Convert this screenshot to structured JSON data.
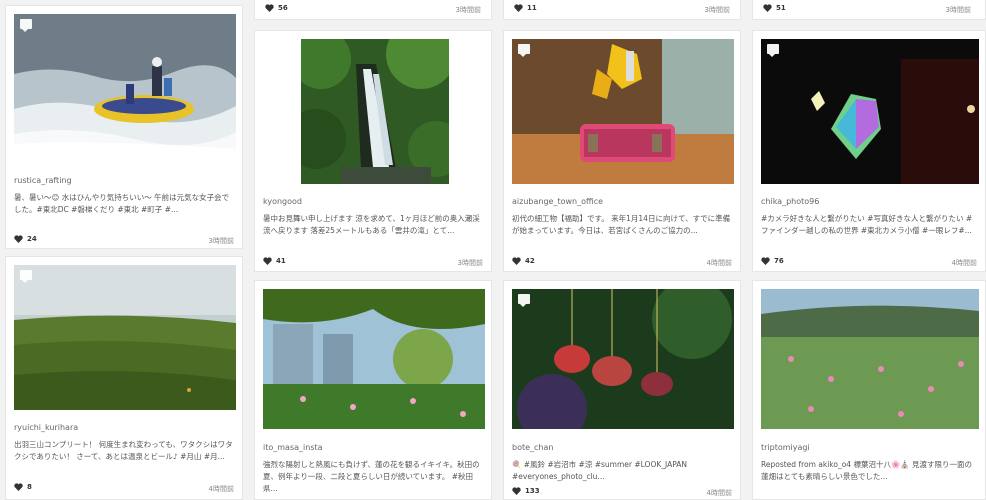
{
  "top_row": [
    {
      "likes": "56",
      "time": "3時間前"
    },
    {
      "likes": "11",
      "time": "3時間前"
    },
    {
      "likes": "51",
      "time": "3時間前"
    }
  ],
  "cards": [
    {
      "user": "rustica_rafting",
      "caption": "暑、暑い〜😊 水はひんやり気持ちいい〜 午前は元気な女子会でした。#東北DC #磐梯くだり #東北 #町子 #...",
      "likes": "24",
      "time": "3時間前"
    },
    {
      "user": "kyongood",
      "caption": "暑中お見舞い申し上げます 涼を求めて、1ヶ月ほど前の奥入瀬渓流へ戻ります 落差25メートルもある「雲井の滝」とて...",
      "likes": "41",
      "time": "3時間前"
    },
    {
      "user": "aizubange_town_office",
      "caption": "初代の細工物【福助】です。 来年1月14日に向けて、すでに準備が始まっています。今日は、若宮ばくさんのご協力の...",
      "likes": "42",
      "time": "4時間前"
    },
    {
      "user": "chika_photo96",
      "caption": "#カメラ好きな人と繋がりたい #写真好きな人と繋がりたい #ファインダー越しの私の世界 #東北カメラ小僧 #一眼レフ#...",
      "likes": "76",
      "time": "4時間前"
    },
    {
      "user": "ryuichi_kurihara",
      "caption": "出羽三山コンプリート！ 何度生まれ変わっても、ワタクシはワタクシでありたい！ さーて、あとは温泉とビール♪ #月山 #月...",
      "likes": "8",
      "time": "4時間前"
    },
    {
      "user": "ito_masa_insta",
      "caption": "強烈な陽射しと熱風にも負けず、蓮の花を観るイキイキ。秋田の夏、例年より一段、二段と夏らしい日が続いています。 #秋田県...",
      "likes": "",
      "time": ""
    },
    {
      "user": "bote_chan",
      "caption": "🍭 #風鈴 #岩沼市 #涼 #summer #LOOK_JAPAN #everyones_photo_clu...",
      "likes": "133",
      "time": "4時間前"
    },
    {
      "user": "triptomiyagi",
      "caption": "Reposted from akiko_o4 標葉沼十八🌸⛪ 見渡す限り一面の蓮畑はとても素晴らしい景色でした...",
      "likes": "",
      "time": ""
    }
  ],
  "colors": {
    "accent": "#333333",
    "border": "#e6e6e6",
    "background": "#f2f2f2"
  }
}
